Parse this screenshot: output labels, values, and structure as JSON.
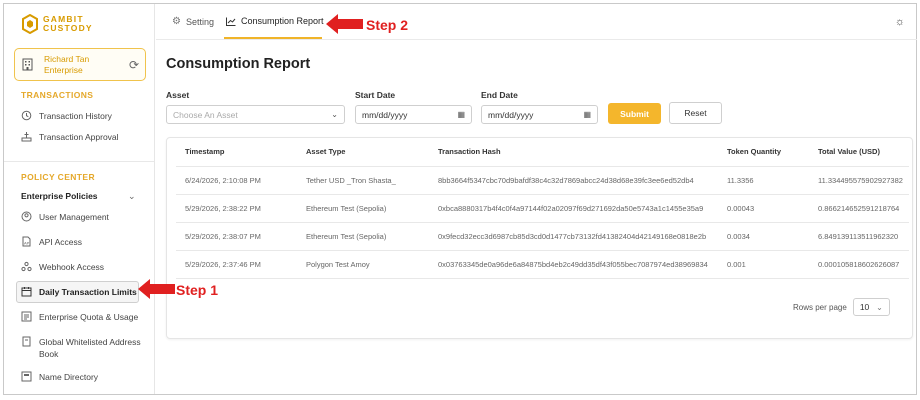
{
  "brand": {
    "line1": "GAMBIT",
    "line2": "CUSTODY",
    "color": "#D89B00"
  },
  "user": {
    "name": "Richard Tan Enterprise",
    "refresh_icon": "refresh-icon"
  },
  "sidebar": {
    "transactions_title": "TRANSACTIONS",
    "transactions": [
      {
        "label": "Transaction History",
        "icon": "history-icon"
      },
      {
        "label": "Transaction Approval",
        "icon": "approval-icon"
      }
    ],
    "policy_title": "POLICY CENTER",
    "enterprise_policies": "Enterprise Policies",
    "policies": [
      {
        "label": "User Management",
        "icon": "user-icon"
      },
      {
        "label": "API Access",
        "icon": "api-icon"
      },
      {
        "label": "Webhook Access",
        "icon": "webhook-icon"
      },
      {
        "label": "Daily Transaction Limits",
        "icon": "calendar-icon"
      },
      {
        "label": "Enterprise Quota & Usage",
        "icon": "quota-icon"
      },
      {
        "label": "Global Whitelisted Address Book",
        "icon": "book-icon"
      },
      {
        "label": "Name Directory",
        "icon": "directory-icon"
      }
    ]
  },
  "topbar": {
    "tabs": [
      {
        "label": "Setting",
        "icon": "gear-icon"
      },
      {
        "label": "Consumption Report",
        "icon": "chart-icon"
      }
    ]
  },
  "main": {
    "title": "Consumption Report",
    "asset_label": "Asset",
    "asset_placeholder": "Choose An Asset",
    "start_label": "Start Date",
    "start_value": "mm/dd/yyyy",
    "end_label": "End Date",
    "end_value": "mm/dd/yyyy",
    "submit": "Submit",
    "reset": "Reset"
  },
  "table": {
    "headers": [
      "Timestamp",
      "Asset Type",
      "Transaction Hash",
      "Token Quantity",
      "Total Value (USD)"
    ],
    "rows": [
      [
        "6/24/2026, 2:10:08 PM",
        "Tether USD _Tron Shasta_",
        "8bb3664f5347cbc70d9bafdf38c4c32d7869abcc24d38d68e39fc3ee6ed52db4",
        "11.3356",
        "11.334495575902927382"
      ],
      [
        "5/29/2026, 2:38:22 PM",
        "Ethereum Test (Sepolia)",
        "0xbca8880317b4f4c0f4a97144f02a02097f69d271692da50e5743a1c1455e35a9",
        "0.00043",
        "0.866214652591218764"
      ],
      [
        "5/29/2026, 2:38:07 PM",
        "Ethereum Test (Sepolia)",
        "0x9fecd32ecc3d6987cb85d3cd0d1477cb73132fd41382404d42149168e0818e2b",
        "0.0034",
        "6.849139113511962320"
      ],
      [
        "5/29/2026, 2:37:46 PM",
        "Polygon Test Amoy",
        "0x03763345de0a96de6a84875bd4eb2c49dd35df43f055bec7087974ed38969834",
        "0.001",
        "0.000105818602626087"
      ]
    ]
  },
  "pagination": {
    "label": "Rows per page",
    "value": "10"
  },
  "annotations": {
    "step1": "Step 1",
    "step2": "Step 2",
    "color": "#E02020"
  }
}
